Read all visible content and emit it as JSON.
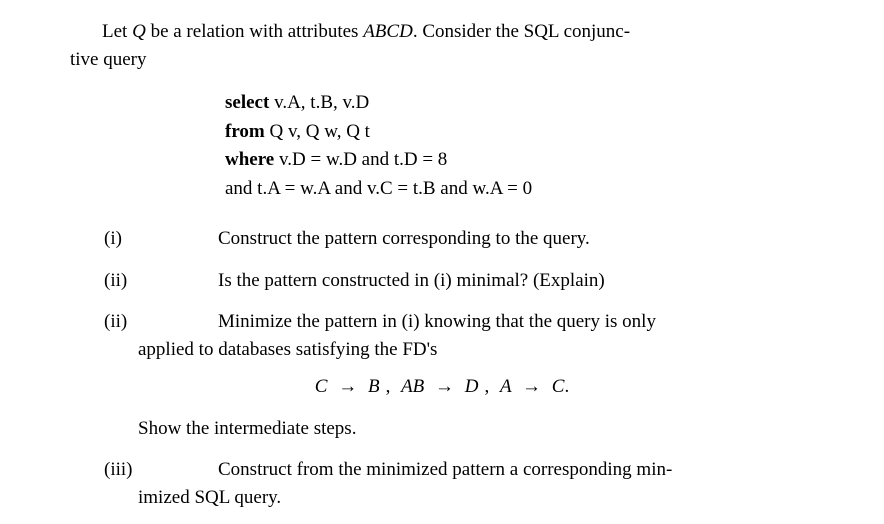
{
  "intro": {
    "line1_prefix": "Let ",
    "Q": "Q",
    "line1_mid": " be a relation with attributes ",
    "ABCD": "ABCD",
    "line1_suffix": ". Consider the SQL conjunc-",
    "line2": "tive query"
  },
  "query": {
    "select_kw": "select",
    "select_args": " v.A, t.B, v.D",
    "from_kw": "from",
    "from_args": " Q v, Q w, Q t",
    "where_kw": "where",
    "where_args": " v.D = w.D and t.D = 8",
    "and_line": "and t.A = w.A and v.C = t.B and w.A = 0"
  },
  "items": {
    "i": {
      "label": "(i)",
      "text": "Construct the pattern corresponding to the query."
    },
    "ii": {
      "label": "(ii)",
      "text": "Is the pattern constructed in (i) minimal? (Explain)"
    },
    "ii2": {
      "label": "(ii)",
      "text_first": "Minimize the pattern in (i) knowing that the query is only",
      "text_cont": "applied to databases satisfying the FD's"
    },
    "iii": {
      "label": "(iii)",
      "text_first": "Construct from the minimized pattern a corresponding min-",
      "text_cont": "imized SQL query."
    }
  },
  "fd": {
    "c": "C",
    "arrow1": "→",
    "b": "B",
    "comma1": ",  ",
    "ab": "AB",
    "arrow2": "→",
    "d": "D",
    "comma2": ",  ",
    "a": "A",
    "arrow3": "→",
    "c2": "C",
    "period": "."
  },
  "show_steps": "Show the intermediate steps."
}
